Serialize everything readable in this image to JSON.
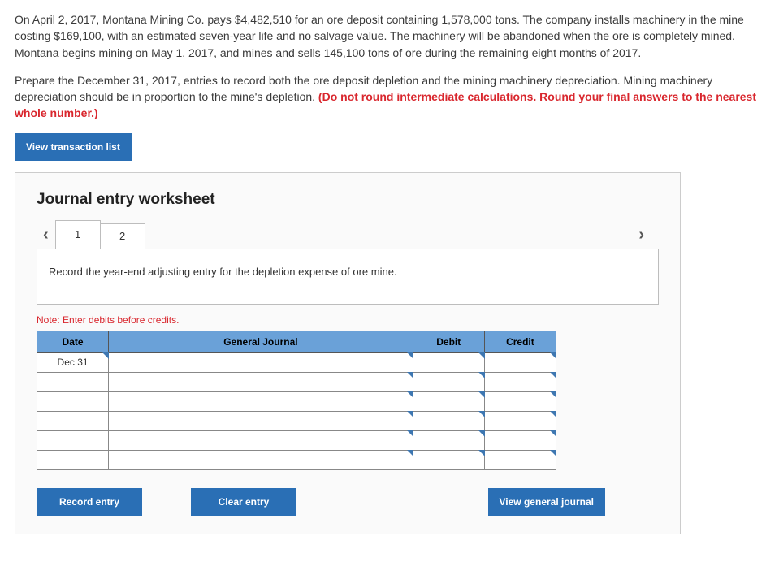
{
  "problem": {
    "para1": "On April 2, 2017, Montana Mining Co. pays $4,482,510 for an ore deposit containing 1,578,000 tons. The company installs machinery in the mine costing $169,100, with an estimated seven-year life and no salvage value. The machinery will be abandoned when the ore is completely mined. Montana begins mining on May 1, 2017, and mines and sells 145,100 tons of ore during the remaining eight months of 2017.",
    "para2_a": "Prepare the December 31, 2017, entries to record both the ore deposit depletion and the mining machinery depreciation. Mining machinery depreciation should be in proportion to the mine's depletion. ",
    "para2_b": "(Do not round intermediate calculations. Round your final answers to the nearest whole number.)"
  },
  "buttons": {
    "view_list": "View transaction list",
    "record": "Record entry",
    "clear": "Clear entry",
    "view_gj": "View general journal"
  },
  "worksheet": {
    "title": "Journal entry worksheet",
    "tabs": [
      "1",
      "2"
    ],
    "instruction": "Record the year-end adjusting entry for the depletion expense of ore mine.",
    "note": "Note: Enter debits before credits.",
    "headers": {
      "date": "Date",
      "gj": "General Journal",
      "debit": "Debit",
      "credit": "Credit"
    },
    "rows": [
      {
        "date": "Dec 31",
        "gj": "",
        "debit": "",
        "credit": ""
      },
      {
        "date": "",
        "gj": "",
        "debit": "",
        "credit": ""
      },
      {
        "date": "",
        "gj": "",
        "debit": "",
        "credit": ""
      },
      {
        "date": "",
        "gj": "",
        "debit": "",
        "credit": ""
      },
      {
        "date": "",
        "gj": "",
        "debit": "",
        "credit": ""
      },
      {
        "date": "",
        "gj": "",
        "debit": "",
        "credit": ""
      }
    ]
  }
}
